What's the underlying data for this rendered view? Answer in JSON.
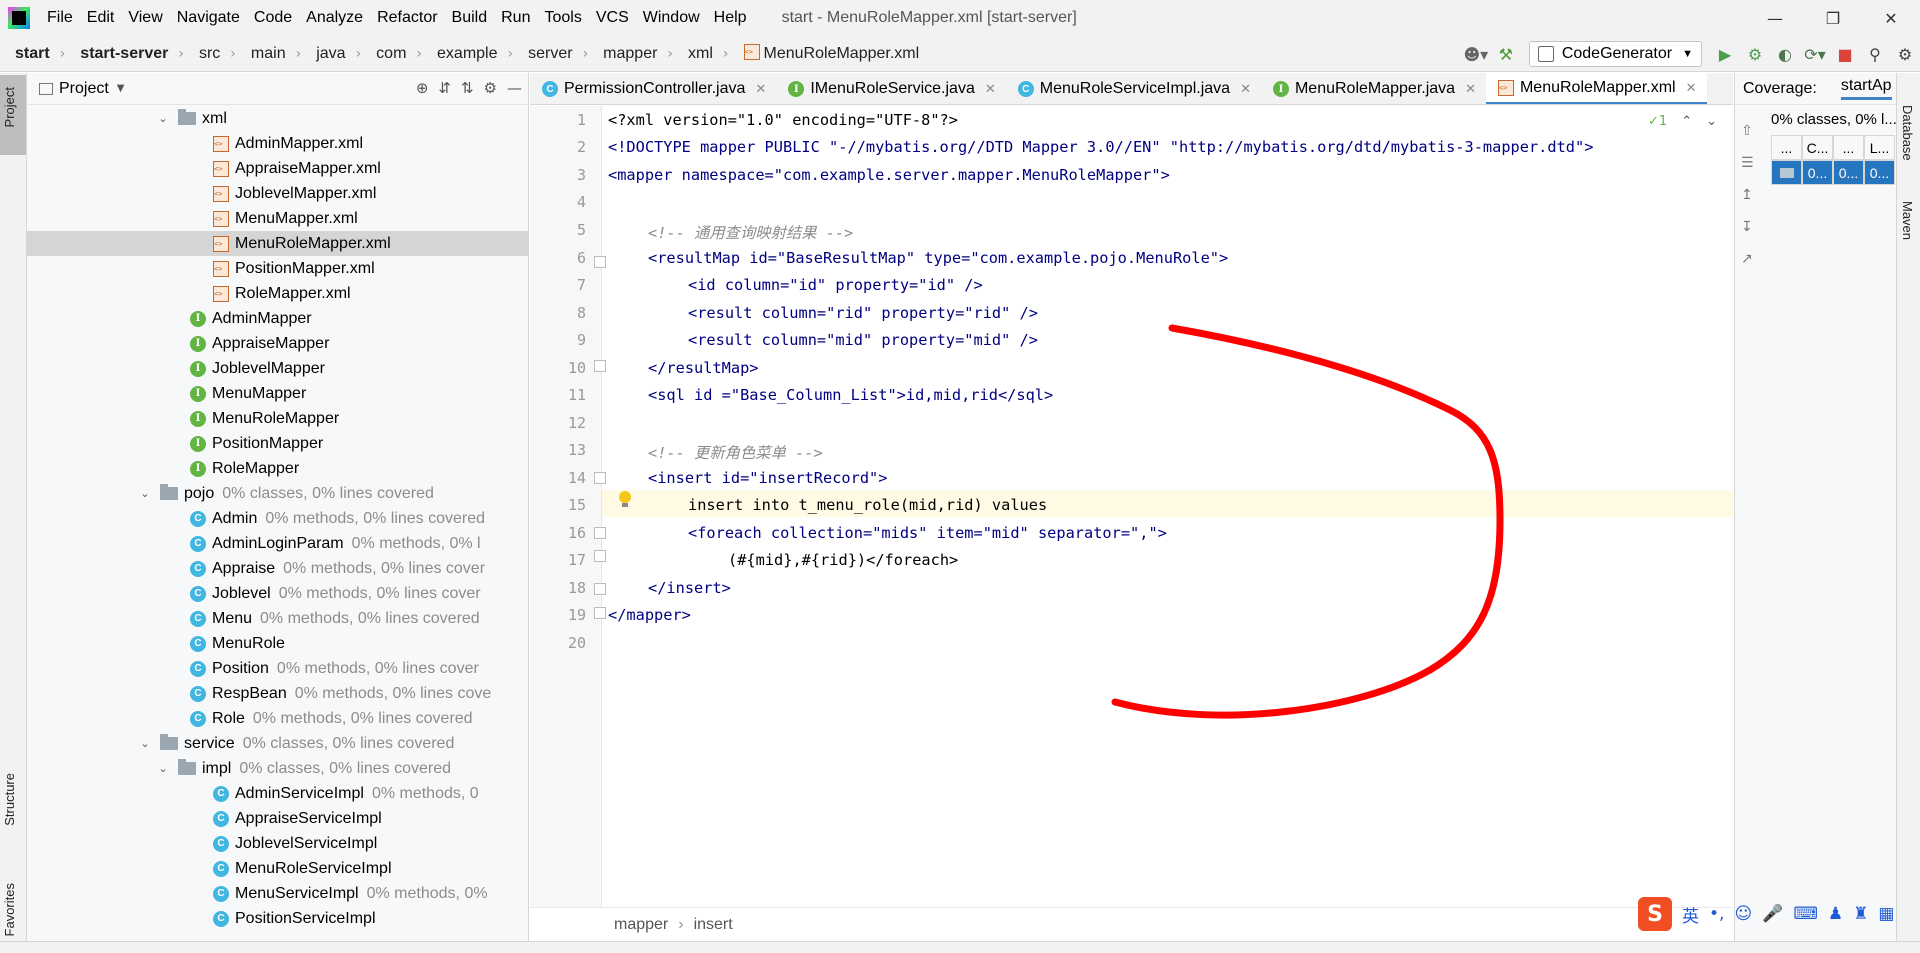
{
  "menubar": {
    "items": [
      "File",
      "Edit",
      "View",
      "Navigate",
      "Code",
      "Analyze",
      "Refactor",
      "Build",
      "Run",
      "Tools",
      "VCS",
      "Window",
      "Help"
    ],
    "window_title": "start - MenuRoleMapper.xml [start-server]"
  },
  "breadcrumbs": [
    "start",
    "start-server",
    "src",
    "main",
    "java",
    "com",
    "example",
    "server",
    "mapper",
    "xml",
    "MenuRoleMapper.xml"
  ],
  "toolbar": {
    "run_config": "CodeGenerator"
  },
  "left_strip": {
    "project": "Project",
    "structure": "Structure",
    "favorites": "Favorites"
  },
  "project_panel": {
    "title": "Project",
    "tree": [
      {
        "type": "folder",
        "depth": 1,
        "name": "xml",
        "coverage": ""
      },
      {
        "type": "xmlfile",
        "depth": 2,
        "name": "AdminMapper.xml",
        "coverage": ""
      },
      {
        "type": "xmlfile",
        "depth": 2,
        "name": "AppraiseMapper.xml",
        "coverage": ""
      },
      {
        "type": "xmlfile",
        "depth": 2,
        "name": "JoblevelMapper.xml",
        "coverage": ""
      },
      {
        "type": "xmlfile",
        "depth": 2,
        "name": "MenuMapper.xml",
        "coverage": ""
      },
      {
        "type": "xmlfile",
        "depth": 2,
        "name": "MenuRoleMapper.xml",
        "coverage": "",
        "selected": true
      },
      {
        "type": "xmlfile",
        "depth": 2,
        "name": "PositionMapper.xml",
        "coverage": ""
      },
      {
        "type": "xmlfile",
        "depth": 2,
        "name": "RoleMapper.xml",
        "coverage": ""
      },
      {
        "type": "interface",
        "depth": 1,
        "name": "AdminMapper",
        "coverage": ""
      },
      {
        "type": "interface",
        "depth": 1,
        "name": "AppraiseMapper",
        "coverage": ""
      },
      {
        "type": "interface",
        "depth": 1,
        "name": "JoblevelMapper",
        "coverage": ""
      },
      {
        "type": "interface",
        "depth": 1,
        "name": "MenuMapper",
        "coverage": ""
      },
      {
        "type": "interface",
        "depth": 1,
        "name": "MenuRoleMapper",
        "coverage": ""
      },
      {
        "type": "interface",
        "depth": 1,
        "name": "PositionMapper",
        "coverage": ""
      },
      {
        "type": "interface",
        "depth": 1,
        "name": "RoleMapper",
        "coverage": ""
      },
      {
        "type": "folder",
        "depth": 0,
        "name": "pojo",
        "coverage": "0% classes, 0% lines covered"
      },
      {
        "type": "class",
        "depth": 1,
        "name": "Admin",
        "coverage": "0% methods, 0% lines covered"
      },
      {
        "type": "class",
        "depth": 1,
        "name": "AdminLoginParam",
        "coverage": "0% methods, 0% l"
      },
      {
        "type": "class",
        "depth": 1,
        "name": "Appraise",
        "coverage": "0% methods, 0% lines cover"
      },
      {
        "type": "class",
        "depth": 1,
        "name": "Joblevel",
        "coverage": "0% methods, 0% lines cover"
      },
      {
        "type": "class",
        "depth": 1,
        "name": "Menu",
        "coverage": "0% methods, 0% lines covered"
      },
      {
        "type": "class",
        "depth": 1,
        "name": "MenuRole",
        "coverage": ""
      },
      {
        "type": "class",
        "depth": 1,
        "name": "Position",
        "coverage": "0% methods, 0% lines cover"
      },
      {
        "type": "class",
        "depth": 1,
        "name": "RespBean",
        "coverage": "0% methods, 0% lines cove"
      },
      {
        "type": "class",
        "depth": 1,
        "name": "Role",
        "coverage": "0% methods, 0% lines covered"
      },
      {
        "type": "folder",
        "depth": 0,
        "name": "service",
        "coverage": "0% classes, 0% lines covered"
      },
      {
        "type": "folder",
        "depth": 1,
        "name": "impl",
        "coverage": "0% classes, 0% lines covered"
      },
      {
        "type": "class",
        "depth": 2,
        "name": "AdminServiceImpl",
        "coverage": "0% methods, 0"
      },
      {
        "type": "class",
        "depth": 2,
        "name": "AppraiseServiceImpl",
        "coverage": ""
      },
      {
        "type": "class",
        "depth": 2,
        "name": "JoblevelServiceImpl",
        "coverage": ""
      },
      {
        "type": "class",
        "depth": 2,
        "name": "MenuRoleServiceImpl",
        "coverage": ""
      },
      {
        "type": "class",
        "depth": 2,
        "name": "MenuServiceImpl",
        "coverage": "0% methods, 0%"
      },
      {
        "type": "class",
        "depth": 2,
        "name": "PositionServiceImpl",
        "coverage": ""
      }
    ]
  },
  "tabs": [
    {
      "label": "PermissionController.java",
      "icon": "class-icon",
      "active": false
    },
    {
      "label": "IMenuRoleService.java",
      "icon": "interface-icon",
      "active": false
    },
    {
      "label": "MenuRoleServiceImpl.java",
      "icon": "class-icon",
      "active": false
    },
    {
      "label": "MenuRoleMapper.java",
      "icon": "interface-icon",
      "active": false
    },
    {
      "label": "MenuRoleMapper.xml",
      "icon": "xml-icon",
      "active": true
    }
  ],
  "editor": {
    "line_numbers": [
      "1",
      "2",
      "3",
      "4",
      "5",
      "6",
      "7",
      "8",
      "9",
      "10",
      "11",
      "12",
      "13",
      "14",
      "15",
      "16",
      "17",
      "18",
      "19",
      "20"
    ],
    "code": {
      "l1": "<?xml version=\"1.0\" encoding=\"UTF-8\"?>",
      "l2": "<!DOCTYPE mapper PUBLIC \"-//mybatis.org//DTD Mapper 3.0//EN\" \"http://mybatis.org/dtd/mybatis-3-mapper.dtd\">",
      "l3": "<mapper namespace=\"com.example.server.mapper.MenuRoleMapper\">",
      "l5": "<!-- 通用查询映射结果 -->",
      "l6": "<resultMap id=\"BaseResultMap\" type=\"com.example.pojo.MenuRole\">",
      "l7": "<id column=\"id\" property=\"id\" />",
      "l8": "<result column=\"rid\" property=\"rid\" />",
      "l9": "<result column=\"mid\" property=\"mid\" />",
      "l10": "</resultMap>",
      "l11": "<sql id =\"Base_Column_List\">id,mid,rid</sql>",
      "l13": "<!-- 更新角色菜单 -->",
      "l14": "<insert id=\"insertRecord\">",
      "l15": "insert into t_menu_role(mid,rid) values",
      "l16": "<foreach collection=\"mids\" item=\"mid\" separator=\",\">",
      "l17": "(#{mid},#{rid})</foreach>",
      "l18": "</insert>",
      "l19": "</mapper>"
    },
    "inspection_count": "1",
    "crumbs": [
      "mapper",
      "insert"
    ]
  },
  "coverage_panel": {
    "title": "Coverage:",
    "tab": "startAp",
    "summary": "0% classes, 0% l...",
    "headers": [
      "...",
      "C...",
      "...",
      "L..."
    ],
    "row": [
      "",
      "0...",
      "0...",
      "0..."
    ]
  },
  "right_strip": {
    "database": "Database",
    "maven": "Maven"
  },
  "ime": {
    "lang": "英",
    "punct": "•,"
  },
  "colors": {
    "accent": "#4083c9",
    "selection": "#2675bf",
    "annotation": "#ff0000",
    "highlight_line": "#fffae3"
  }
}
